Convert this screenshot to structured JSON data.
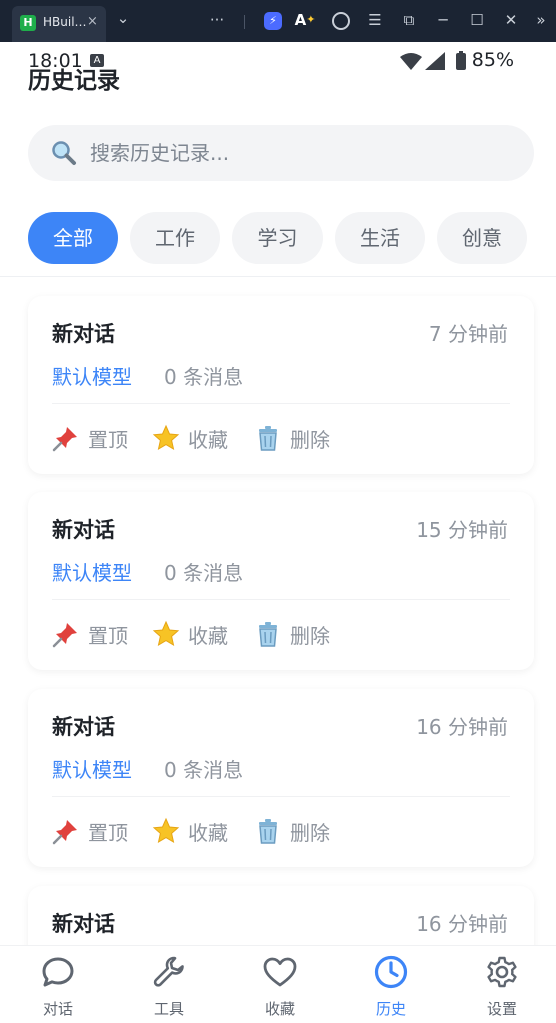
{
  "browser": {
    "tab_title": "HBuil…",
    "favicon_letter": "H",
    "close_glyph": "×",
    "dropdown_glyph": "⌄",
    "more_glyph": "···"
  },
  "status_bar": {
    "time": "18:01",
    "battery": "85%"
  },
  "page": {
    "title": "历史记录"
  },
  "search": {
    "placeholder": "搜索历史记录..."
  },
  "filters": {
    "items": [
      "全部",
      "工作",
      "学习",
      "生活",
      "创意"
    ],
    "active_index": 0
  },
  "records": [
    {
      "title": "新对话",
      "time": "7 分钟前",
      "model": "默认模型",
      "count": "0 条消息"
    },
    {
      "title": "新对话",
      "time": "15 分钟前",
      "model": "默认模型",
      "count": "0 条消息"
    },
    {
      "title": "新对话",
      "time": "16 分钟前",
      "model": "默认模型",
      "count": "0 条消息"
    },
    {
      "title": "新对话",
      "time": "16 分钟前"
    }
  ],
  "actions": {
    "pin": "置顶",
    "favorite": "收藏",
    "delete": "删除"
  },
  "bottom_nav": {
    "items": [
      {
        "label": "对话",
        "icon": "chat-bubble-icon"
      },
      {
        "label": "工具",
        "icon": "wrench-icon"
      },
      {
        "label": "收藏",
        "icon": "heart-icon"
      },
      {
        "label": "历史",
        "icon": "clock-icon"
      },
      {
        "label": "设置",
        "icon": "gear-icon"
      }
    ],
    "active_index": 3
  },
  "colors": {
    "accent": "#3d85f7",
    "chrome_bg": "#1b2433",
    "chip_bg": "#f3f4f6",
    "muted_text": "#8f959e"
  }
}
